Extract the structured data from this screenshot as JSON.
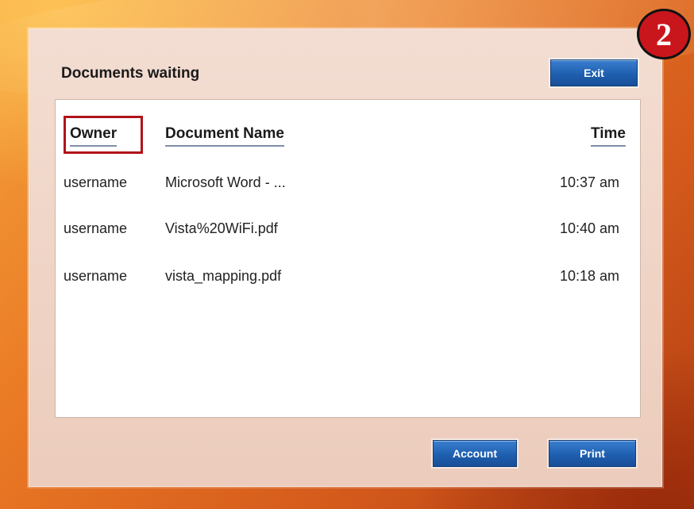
{
  "dialog": {
    "title": "Documents waiting",
    "exit_label": "Exit",
    "account_label": "Account",
    "print_label": "Print"
  },
  "table": {
    "headers": {
      "owner": "Owner",
      "document": "Document Name",
      "time": "Time"
    },
    "rows": [
      {
        "owner": "username",
        "document": "Microsoft Word - ...",
        "time": "10:37 am"
      },
      {
        "owner": "username",
        "document": "Vista%20WiFi.pdf",
        "time": "10:40 am"
      },
      {
        "owner": "username",
        "document": "vista_mapping.pdf",
        "time": "10:18 am"
      }
    ]
  },
  "annotation": {
    "step_number": "2",
    "highlight_color": "#b0141a",
    "badge_color": "#c9161c"
  },
  "colors": {
    "button_blue": "#1f5fb0",
    "panel": "#efd4c6",
    "background_orange": "#ea7a25"
  }
}
